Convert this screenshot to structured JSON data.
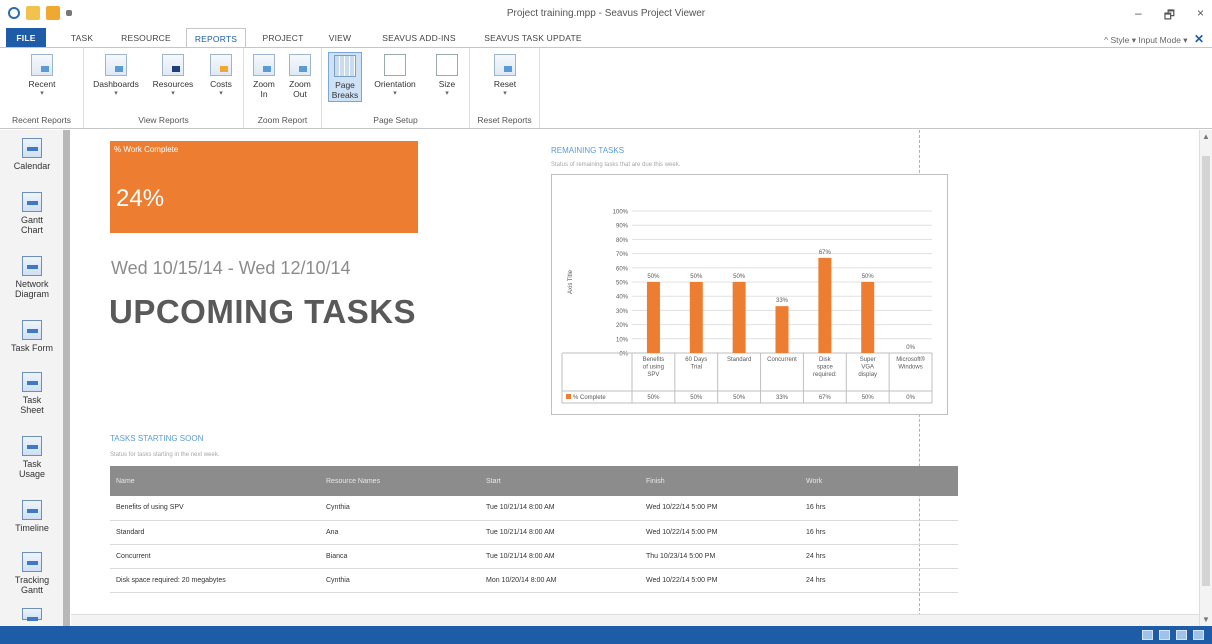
{
  "window": {
    "title": "Project training.mpp - Seavus Project Viewer"
  },
  "window_controls": {
    "minimize": "–",
    "restore": "🗗",
    "close": "×"
  },
  "tabs": [
    {
      "label": "FILE"
    },
    {
      "label": "TASK"
    },
    {
      "label": "RESOURCE"
    },
    {
      "label": "REPORTS"
    },
    {
      "label": "PROJECT"
    },
    {
      "label": "VIEW"
    },
    {
      "label": "SEAVUS ADD-INS"
    },
    {
      "label": "SEAVUS TASK UPDATE"
    }
  ],
  "top_right": {
    "style": "^ Style ▾ Input Mode ▾",
    "close": "✕"
  },
  "ribbon": {
    "groups": {
      "recent_reports": "Recent Reports",
      "view_reports": "View Reports",
      "zoom_report": "Zoom Report",
      "page_setup": "Page Setup",
      "reset_reports": "Reset Reports"
    },
    "buttons": {
      "recent": "Recent",
      "dashboards": "Dashboards",
      "resources": "Resources",
      "costs": "Costs",
      "zoom_in_1": "Zoom",
      "zoom_in_2": "In",
      "zoom_out_1": "Zoom",
      "zoom_out_2": "Out",
      "page_breaks_1": "Page",
      "page_breaks_2": "Breaks",
      "orientation": "Orientation",
      "size": "Size",
      "reset": "Reset"
    }
  },
  "views": {
    "calendar": "Calendar",
    "gantt_1": "Gantt",
    "gantt_2": "Chart",
    "network_1": "Network",
    "network_2": "Diagram",
    "task_form": "Task Form",
    "task_sheet_1": "Task",
    "task_sheet_2": "Sheet",
    "task_usage_1": "Task",
    "task_usage_2": "Usage",
    "timeline": "Timeline",
    "tracking_1": "Tracking",
    "tracking_2": "Gantt"
  },
  "report": {
    "kpi_label": "% Work Complete",
    "kpi_value": "24%",
    "date_range": "Wed 10/15/14 - Wed 12/10/14",
    "heading": "UPCOMING TASKS",
    "remaining_title": "REMAINING TASKS",
    "remaining_subtitle": "Status of remaining tasks that are due this week.",
    "tasks_title": "TASKS STARTING SOON",
    "tasks_subtitle": "Status for tasks starting in the next week."
  },
  "chart_data": {
    "type": "bar",
    "title": "",
    "xlabel": "",
    "ylabel": "Axis Title",
    "ylim": [
      0,
      100
    ],
    "yticks": [
      "0%",
      "10%",
      "20%",
      "30%",
      "40%",
      "50%",
      "60%",
      "70%",
      "80%",
      "90%",
      "100%"
    ],
    "categories": [
      [
        "Benefits",
        "of using",
        "SPV"
      ],
      [
        "60 Days",
        "Trial"
      ],
      [
        "Standard"
      ],
      [
        "Concurrent"
      ],
      [
        "Disk",
        "space",
        "required:"
      ],
      [
        "Super",
        "VGA",
        "display"
      ],
      [
        "Microsoft®",
        "Windows"
      ]
    ],
    "series": [
      {
        "name": "% Complete",
        "values": [
          50,
          50,
          50,
          33,
          67,
          50,
          0
        ],
        "labels": [
          "50%",
          "50%",
          "50%",
          "33%",
          "67%",
          "50%",
          "0%"
        ],
        "color": "#ed7d31"
      }
    ],
    "grid": true,
    "legend": "data-table"
  },
  "tasks_table": {
    "headers": [
      "Name",
      "Resource Names",
      "Start",
      "Finish",
      "Work"
    ],
    "rows": [
      [
        "Benefits of using SPV",
        "Cynthia",
        "Tue 10/21/14 8:00 AM",
        "Wed 10/22/14 5:00 PM",
        "16 hrs"
      ],
      [
        "Standard",
        "Ana",
        "Tue 10/21/14 8:00 AM",
        "Wed 10/22/14 5:00 PM",
        "16 hrs"
      ],
      [
        "Concurrent",
        "Bianca",
        "Tue 10/21/14 8:00 AM",
        "Thu 10/23/14 5:00 PM",
        "24 hrs"
      ],
      [
        "Disk space required: 20 megabytes",
        "Cynthia",
        "Mon 10/20/14 8:00 AM",
        "Wed 10/22/14 5:00 PM",
        "24 hrs"
      ]
    ]
  },
  "colors": {
    "accent": "#1e5ca8",
    "bar": "#ed7d31",
    "heading_blue": "#5b9bd5"
  }
}
